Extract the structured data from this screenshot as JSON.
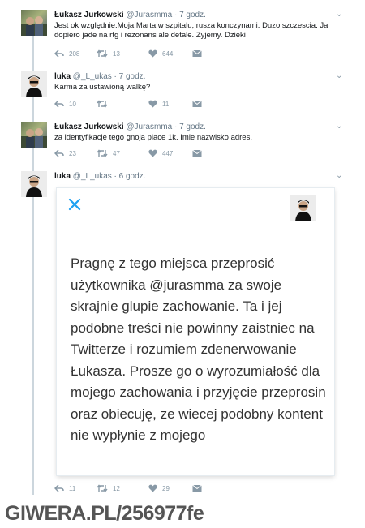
{
  "tweets": [
    {
      "author": "Łukasz Jurkowski",
      "handle": "@Jurasmma",
      "time": "· 7 godz.",
      "text": "Jest ok względnie.Moja Marta w szpitalu, rusza konczynami. Duzo szczescia. Ja dopiero jade na rtg i rezonans ale detale. Zyjemy. Dzieki",
      "replies": "208",
      "retweets": "13",
      "likes": "644"
    },
    {
      "author": "luka",
      "handle": "@_L_ukas",
      "time": "· 7 godz.",
      "text": "Karma za ustawioną walkę?",
      "replies": "10",
      "retweets": "",
      "likes": "11"
    },
    {
      "author": "Łukasz Jurkowski",
      "handle": "@Jurasmma",
      "time": "· 7 godz.",
      "text": "za identyfikacje tego gnoja place 1k. Imie nazwisko adres.",
      "replies": "23",
      "retweets": "47",
      "likes": "447"
    },
    {
      "author": "luka",
      "handle": "@_L_ukas",
      "time": "· 6 godz.",
      "text": "",
      "replies": "11",
      "retweets": "12",
      "likes": "29"
    }
  ],
  "screenshot_card": {
    "text": "Pragnę z tego miejsca przeprosić użytkownika @jurasmma za swoje skrajnie glupie zachowanie. Ta i jej podobne treści nie powinny zaistniec na Twitterze i rozumiem zdenerwowanie Łukasza. Prosze go o wyrozumiałość dla mojego zachowania i przyjęcie przeprosin oraz obiecuję, ze wiecej podobny kontent nie wypłynie z mojego"
  },
  "watermark": {
    "site": "GIWERA.PL/",
    "id": "256977fe"
  },
  "colors": {
    "twitter_blue": "#1da1f2",
    "icon_gray": "#8899a6",
    "text": "#14171a"
  }
}
